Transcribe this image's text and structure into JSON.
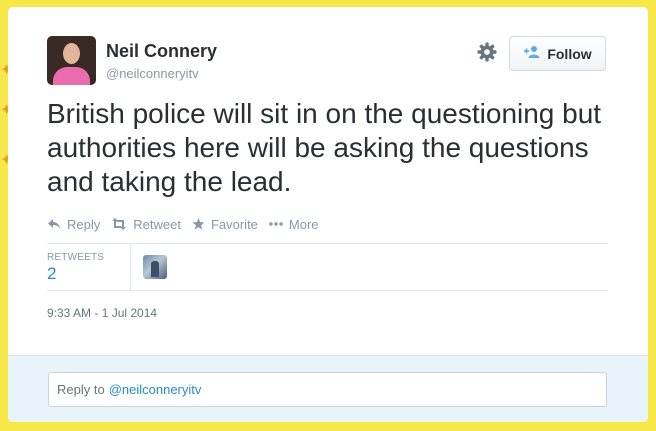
{
  "tweet": {
    "author": {
      "name": "Neil Connery",
      "handle": "@neilconneryitv"
    },
    "follow_label": "Follow",
    "text": "British police will sit in on the questioning but authorities here will be asking the questions and taking the lead.",
    "actions": [
      {
        "label": "Reply",
        "icon": "reply-icon"
      },
      {
        "label": "Retweet",
        "icon": "retweet-icon"
      },
      {
        "label": "Favorite",
        "icon": "star-icon"
      },
      {
        "label": "More",
        "icon": "more-icon"
      }
    ],
    "stats": {
      "retweets_label": "RETWEETS",
      "retweets_count": "2"
    },
    "timestamp": "9:33 AM - 1 Jul 2014",
    "reply": {
      "prefix": "Reply to",
      "mention": "@neilconneryitv"
    }
  },
  "colors": {
    "background": "#f7e84a",
    "link": "#2b8cc4",
    "text": "#292f33",
    "muted": "#8899a6",
    "footer": "#e8f4f9"
  }
}
